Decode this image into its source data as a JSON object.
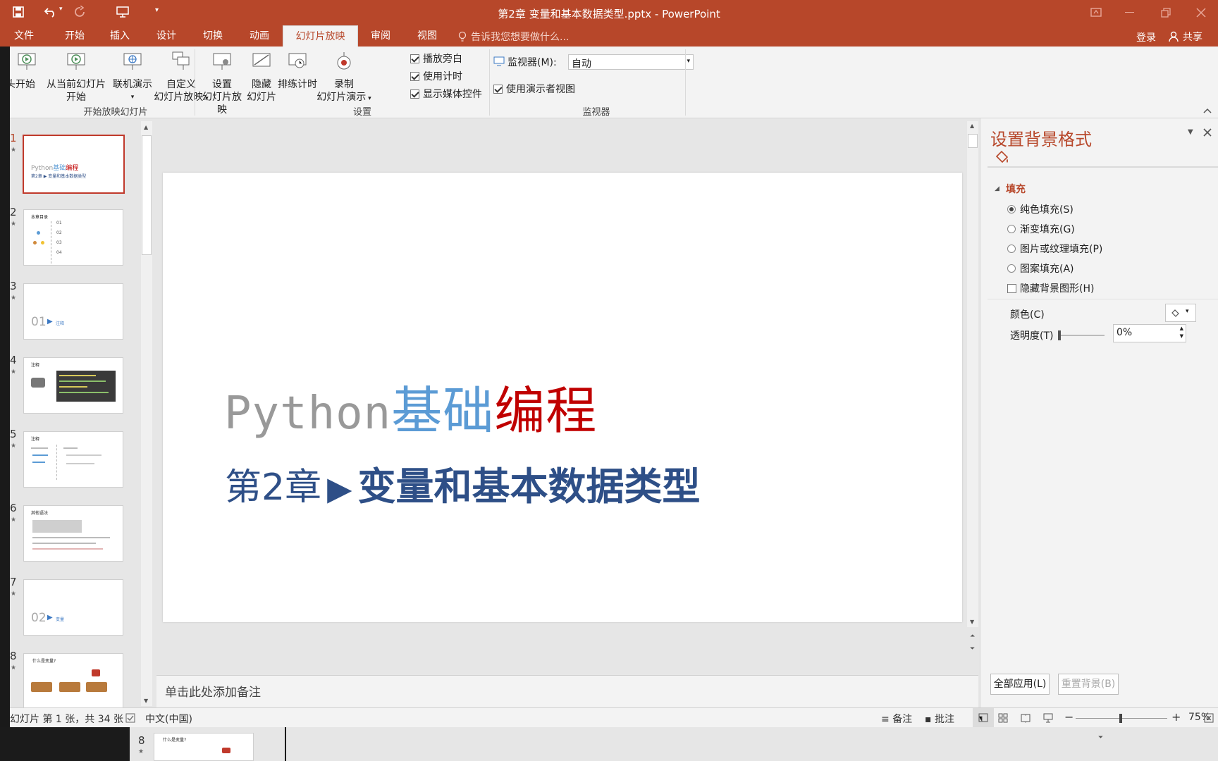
{
  "titlebar": {
    "doc_title": "第2章 变量和基本数据类型.pptx - PowerPoint"
  },
  "tabs": [
    {
      "label": "文件"
    },
    {
      "label": "开始"
    },
    {
      "label": "插入"
    },
    {
      "label": "设计"
    },
    {
      "label": "切换"
    },
    {
      "label": "动画"
    },
    {
      "label": "幻灯片放映"
    },
    {
      "label": "审阅"
    },
    {
      "label": "视图"
    }
  ],
  "tell_me": "告诉我您想要做什么...",
  "login": "登录",
  "share": "共享",
  "ribbon": {
    "from_start": "头开始",
    "from_current_1": "从当前幻灯片",
    "from_current_2": "开始",
    "online": "联机演示",
    "custom_1": "自定义",
    "custom_2": "幻灯片放映",
    "setup_1": "设置",
    "setup_2": "幻灯片放映",
    "hide_1": "隐藏",
    "hide_2": "幻灯片",
    "rehearse": "排练计时",
    "record_1": "录制",
    "record_2": "幻灯片演示",
    "cb_narration": "播放旁白",
    "cb_timing": "使用计时",
    "cb_media": "显示媒体控件",
    "monitor_label": "监视器(M):",
    "monitor_value": "自动",
    "presenter_view": "使用演示者视图",
    "group_start": "开始放映幻灯片",
    "group_setup": "设置",
    "group_monitor": "监视器"
  },
  "thumbnails": [
    {
      "num": "1",
      "title_gray": "Python",
      "title_blue": "基础",
      "title_red": "编程",
      "subtitle": "第2章 ▶ 变量和基本数据类型"
    },
    {
      "num": "2",
      "title": "本章目录",
      "items": [
        "01",
        "02",
        "03",
        "04"
      ]
    },
    {
      "num": "3",
      "big": "01",
      "label": "注释"
    },
    {
      "num": "4",
      "title": "注释"
    },
    {
      "num": "5",
      "title": "注释"
    },
    {
      "num": "6",
      "title": "其他语法"
    },
    {
      "num": "7",
      "big": "02",
      "label": "变量"
    },
    {
      "num": "8",
      "title": "什么是变量?"
    }
  ],
  "slide": {
    "title_gray": "Python",
    "title_blue": "基础",
    "title_red": "编程",
    "chapter": "第2章",
    "arrow": "▶",
    "subtitle": "变量和基本数据类型"
  },
  "notes_placeholder": "单击此处添加备注",
  "pane": {
    "title": "设置背景格式",
    "section": "填充",
    "options": [
      {
        "label": "纯色填充(S)",
        "selected": true
      },
      {
        "label": "渐变填充(G)",
        "selected": false
      },
      {
        "label": "图片或纹理填充(P)",
        "selected": false
      },
      {
        "label": "图案填充(A)",
        "selected": false
      }
    ],
    "hide_bg": "隐藏背景图形(H)",
    "color_label": "颜色(C)",
    "transparency_label": "透明度(T)",
    "transparency_value": "0%",
    "apply_all": "全部应用(L)",
    "reset_bg": "重置背景(B)"
  },
  "status": {
    "slide_info": "幻灯片 第 1 张，共 34 张",
    "language": "中文(中国)",
    "notes": "备注",
    "comments": "批注",
    "zoom": "75%"
  },
  "bottom_strip": {
    "num": "8",
    "title": "什么是变量?"
  },
  "colors": {
    "accent": "#b7472a",
    "title_gray": "#999999",
    "title_blue": "#5b9bd5",
    "title_red": "#c00000",
    "subtitle_navy": "#2e4f87"
  }
}
